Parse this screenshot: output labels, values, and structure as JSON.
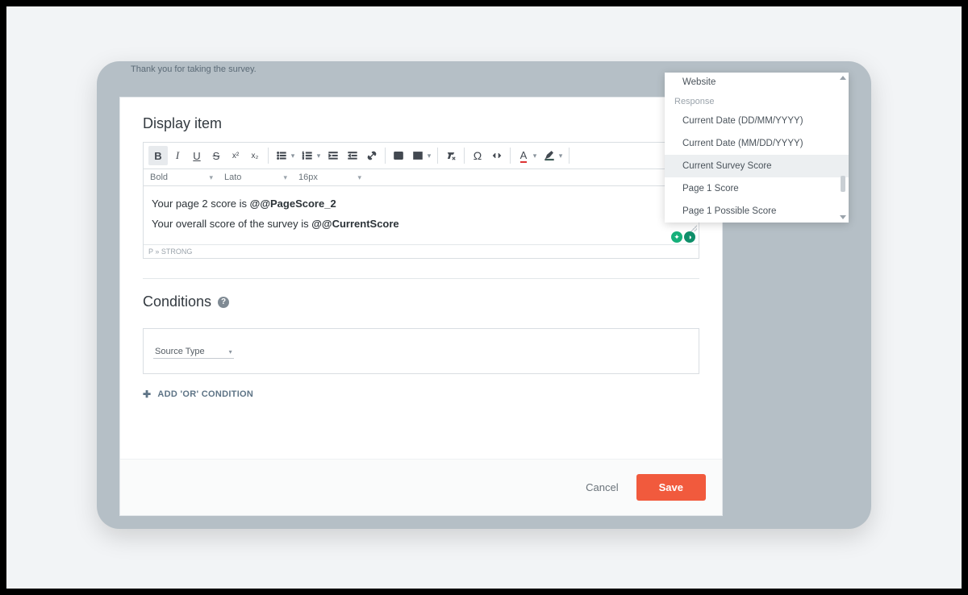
{
  "background_note": "Thank you for taking the survey.",
  "display_item_title": "Display item",
  "toolbar2": {
    "weight": "Bold",
    "font": "Lato",
    "size": "16px"
  },
  "editor": {
    "line1_prefix": "Your page 2 score is ",
    "line1_token": "@@PageScore_2",
    "line2_prefix": "Your overall score of the survey is ",
    "line2_token": "@@CurrentScore",
    "path": "P » STRONG"
  },
  "conditions": {
    "title": "Conditions",
    "source_label": "Source Type",
    "add_or": "ADD 'OR' CONDITION"
  },
  "footer": {
    "cancel": "Cancel",
    "save": "Save"
  },
  "dropdown": {
    "top_item": "Website",
    "group": "Response",
    "items": [
      "Current Date (DD/MM/YYYY)",
      "Current Date (MM/DD/YYYY)",
      "Current Survey Score",
      "Page 1 Score",
      "Page 1 Possible Score"
    ],
    "selected_index": 2
  }
}
